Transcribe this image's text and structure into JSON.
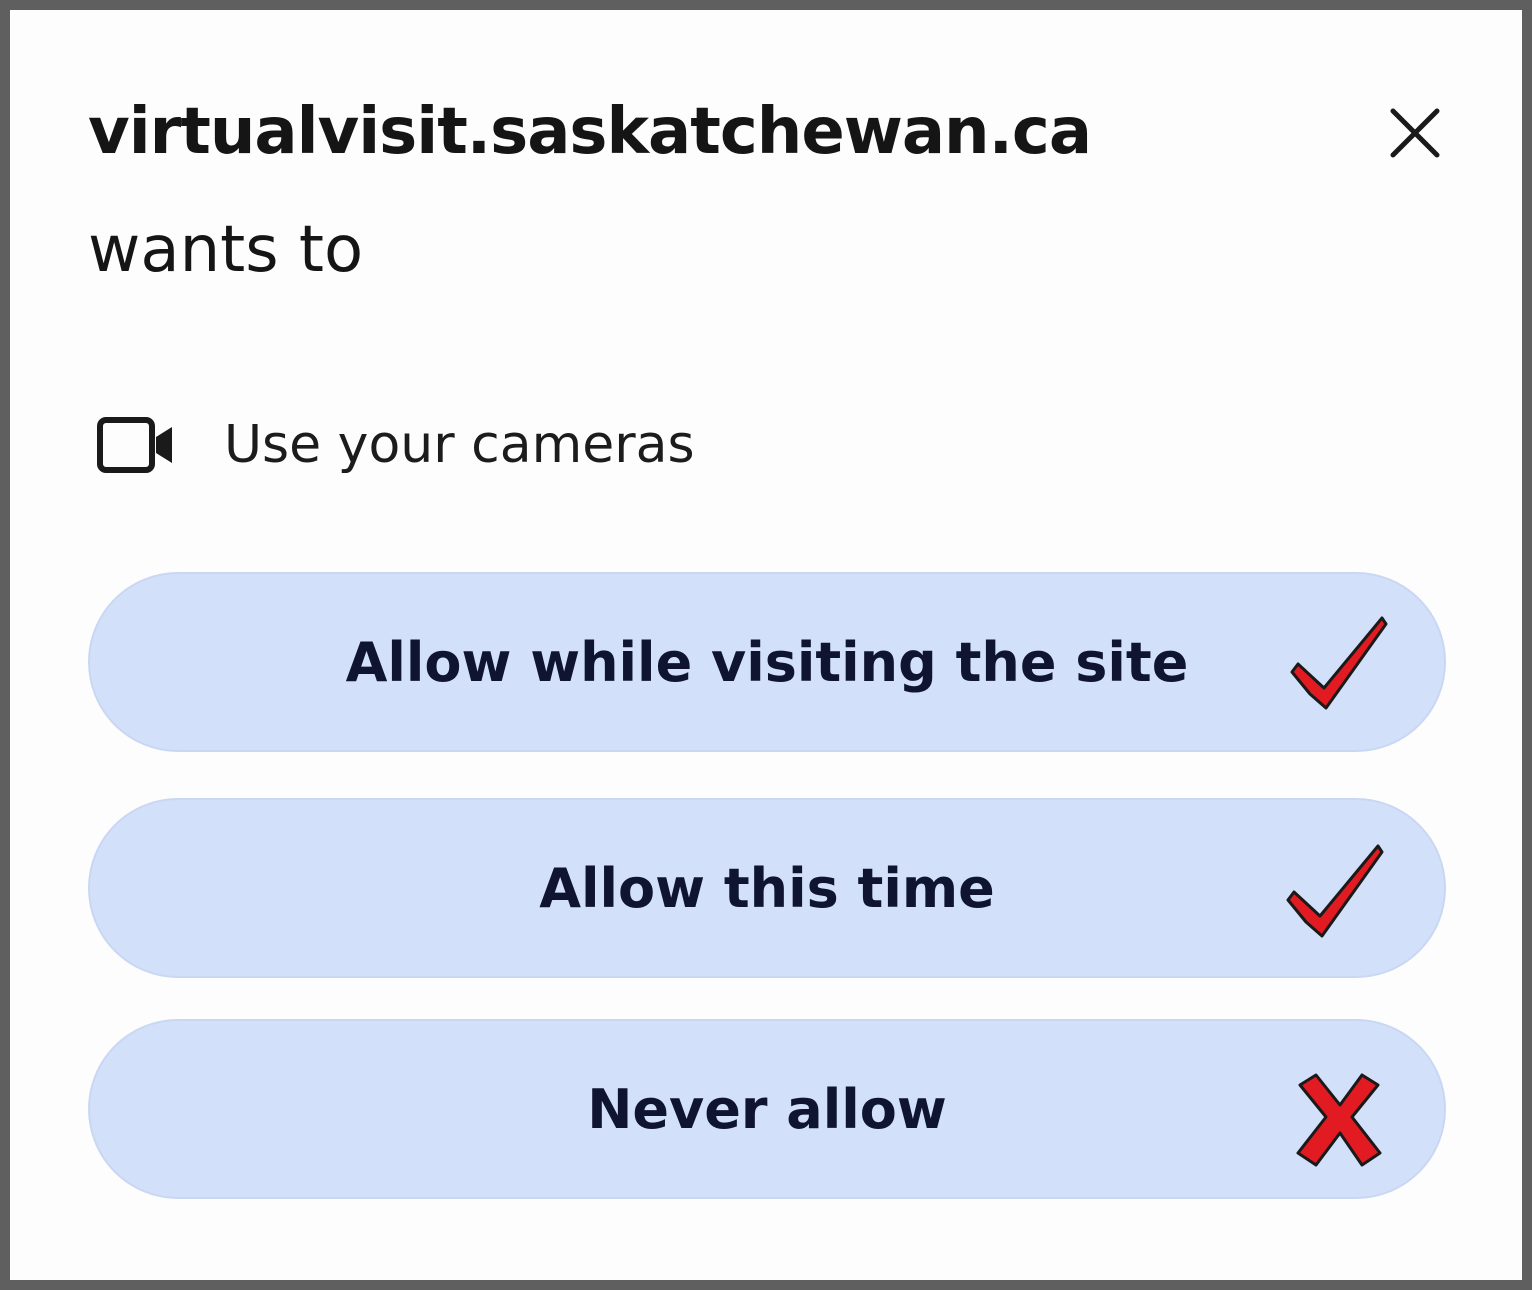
{
  "dialog": {
    "site": "virtualvisit.saskatchewan.ca",
    "subtitle": "wants to",
    "close_icon": "close-icon",
    "permission": {
      "icon": "video-camera-icon",
      "label": "Use your cameras"
    },
    "options": [
      {
        "label": "Allow while visiting the site",
        "mark": "check",
        "mark_color": "#e21b23"
      },
      {
        "label": "Allow this time",
        "mark": "check",
        "mark_color": "#e21b23"
      },
      {
        "label": "Never allow",
        "mark": "cross",
        "mark_color": "#e21b23"
      }
    ],
    "colors": {
      "button_bg": "#d3e0fa",
      "button_text": "#0f1530",
      "frame": "#5f5f5f"
    }
  }
}
